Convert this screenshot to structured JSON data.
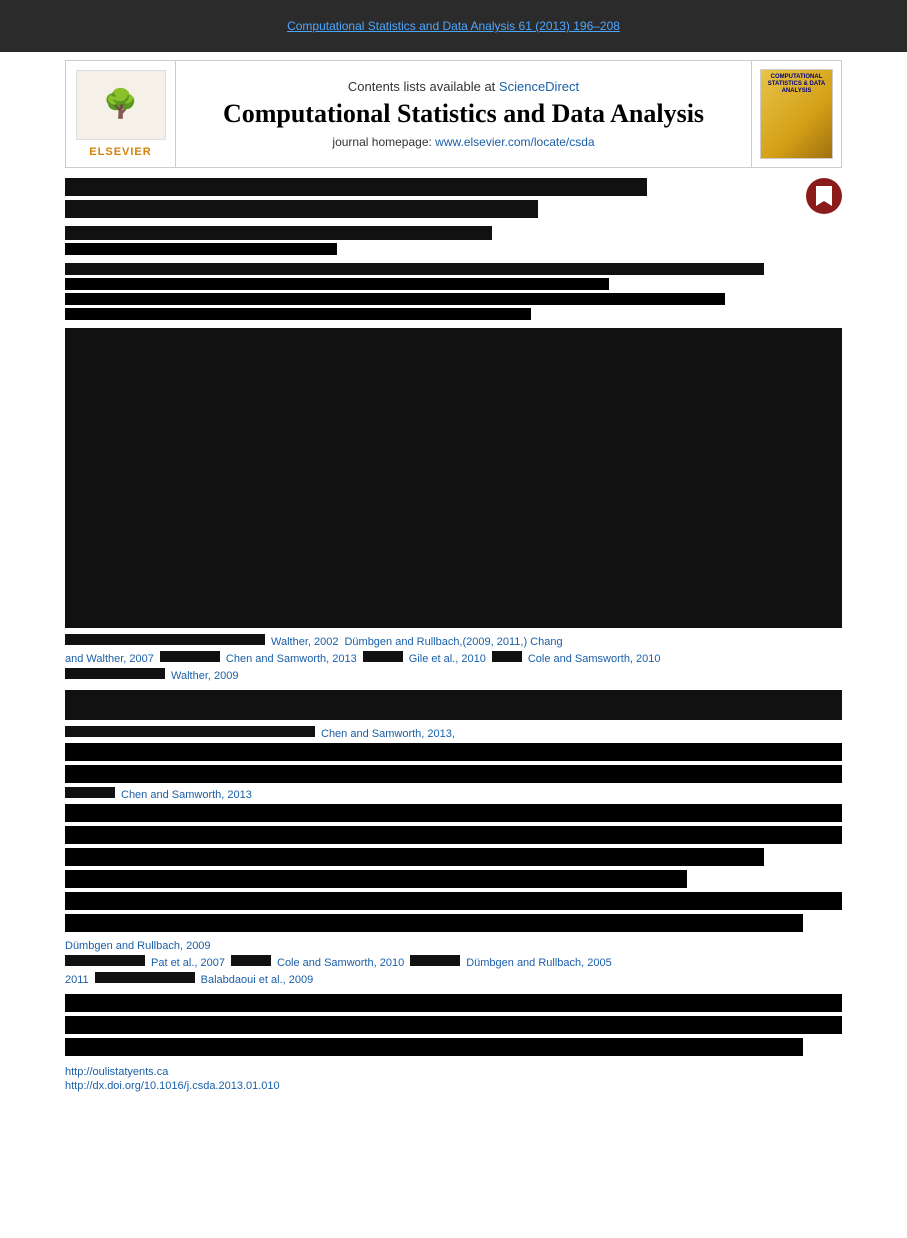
{
  "browser_bar": {
    "url": "Computational Statistics and Data Analysis 61 (2013) 196–208"
  },
  "journal_header": {
    "available_text": "Contents lists available at",
    "science_direct": "ScienceDirect",
    "title": "Computational Statistics and Data Analysis",
    "homepage_label": "journal homepage:",
    "homepage_url": "www.elsevier.com/locate/csda",
    "elsevier_label": "ELSEVIER",
    "right_logo_title": "COMPUTATIONAL STATISTICS & DATA ANALYSIS"
  },
  "citations": {
    "line1": "Walther, 2002",
    "line2": "Dümbgen and Rullbach,(2009, 2011,) Chang",
    "line3": "and Walther, 2007",
    "line4": "Chen and Samworth, 2013",
    "line5": "Gile et al., 2010",
    "line6": "Cole and Samsworth, 2010",
    "line7": "Walther, 2009",
    "line8": "Chen and Samworth, 2013,",
    "line9": "Chen and Samworth, 2013",
    "line10": "Dümbgen and Rullbach, 2009",
    "line11": "Pat et al., 2007",
    "line12": "Cole and Samworth, 2010",
    "line13": "Dümbgen and Rullbach, 2005",
    "line14": "2011",
    "line15": "Balabdaoui et al., 2009"
  },
  "footer": {
    "email": "http://oulistatyents.ca",
    "doi": "http://dx.doi.org/10.1016/j.csda.2013.01.010"
  }
}
